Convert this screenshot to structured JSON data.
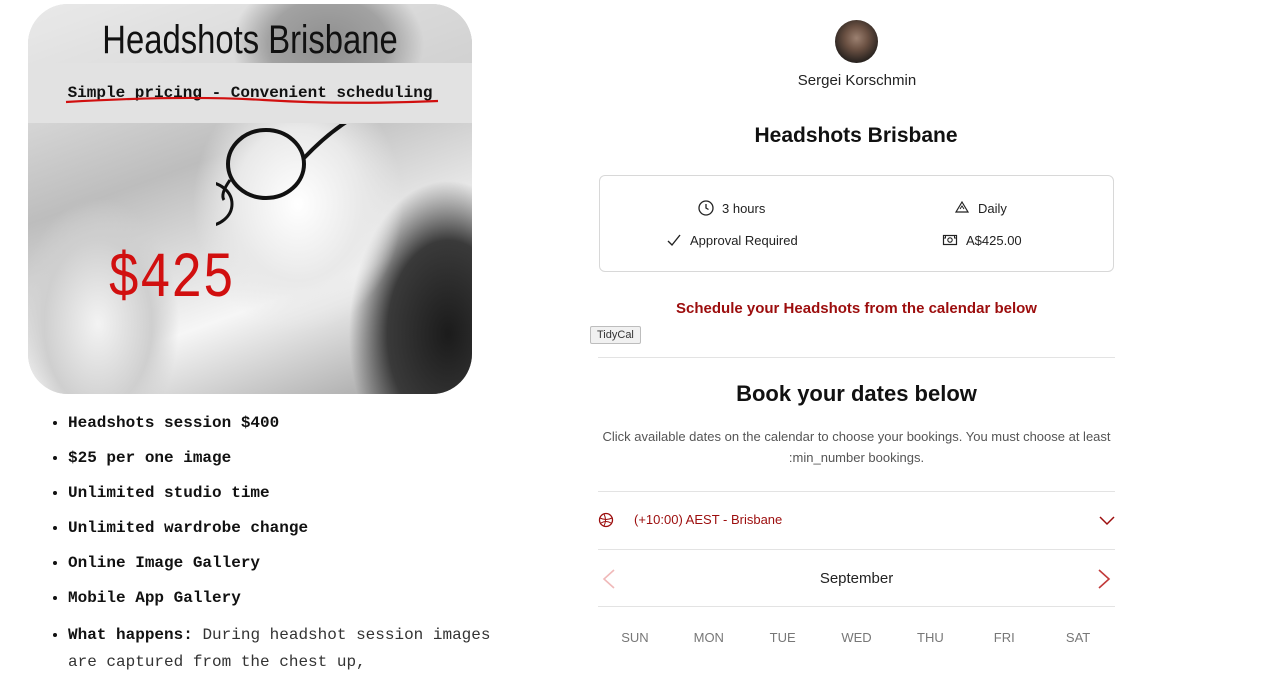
{
  "promo": {
    "title": "Headshots Brisbane",
    "subtitle": "Simple pricing - Convenient scheduling",
    "price": "$425"
  },
  "features": [
    "Headshots session $400",
    "$25 per one image",
    "Unlimited studio time",
    "Unlimited wardrobe change",
    "Online Image Gallery",
    "Mobile App Gallery"
  ],
  "features_extra": {
    "label": "What happens:",
    "text": "During headshot session images are captured from the chest up,"
  },
  "host": {
    "name": "Sergei Korschmin"
  },
  "event": {
    "title": "Headshots Brisbane",
    "duration": "3 hours",
    "frequency": "Daily",
    "approval": "Approval Required",
    "price": "A$425.00"
  },
  "cta": "Schedule your Headshots from the calendar below",
  "tag": "TidyCal",
  "booking": {
    "title": "Book your dates below",
    "description_line1": "Click available dates on the calendar to choose your bookings. You must choose at least",
    "description_line2": ":min_number bookings."
  },
  "timezone": {
    "label": "(+10:00) AEST - Brisbane"
  },
  "calendar": {
    "month": "September",
    "weekdays": [
      "SUN",
      "MON",
      "TUE",
      "WED",
      "THU",
      "FRI",
      "SAT"
    ]
  },
  "colors": {
    "accent": "#9c0d0d",
    "price_red": "#d10f0f"
  },
  "icons": {
    "duration": "clock-icon",
    "frequency": "recycle-icon",
    "approval": "check-icon",
    "price": "money-icon",
    "timezone": "globe-icon",
    "timezone_toggle": "chevron-down-icon",
    "prev_month": "chevron-left-icon",
    "next_month": "chevron-right-icon"
  }
}
